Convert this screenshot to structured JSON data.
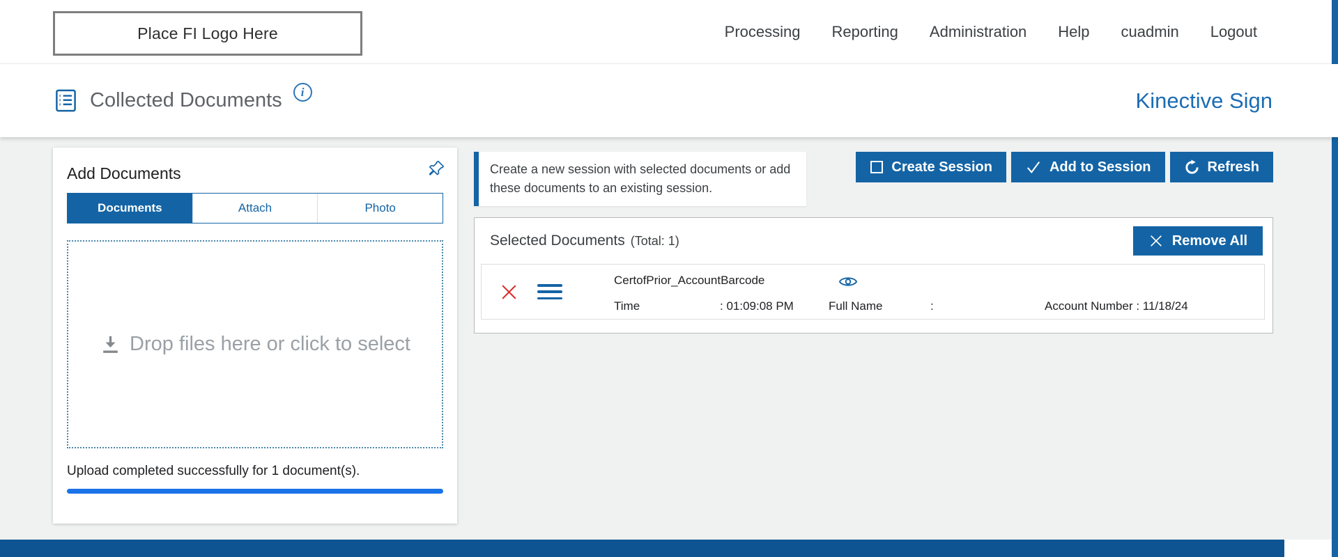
{
  "topnav": {
    "logo_text": "Place FI Logo Here",
    "items": [
      "Processing",
      "Reporting",
      "Administration",
      "Help",
      "cuadmin",
      "Logout"
    ]
  },
  "header": {
    "title": "Collected Documents",
    "info_symbol": "i",
    "brand": "Kinective Sign"
  },
  "add_documents": {
    "title": "Add Documents",
    "tabs": [
      "Documents",
      "Attach",
      "Photo"
    ],
    "dropzone_text": "Drop files here or click to select",
    "status_text": "Upload completed successfully for 1 document(s)."
  },
  "session_actions": {
    "info_text": "Create a new session with selected documents or add these documents to an existing session.",
    "create_label": "Create Session",
    "add_label": "Add to Session",
    "refresh_label": "Refresh"
  },
  "selected_documents": {
    "title": "Selected Documents",
    "total_text": "(Total: 1)",
    "remove_all_label": "Remove All",
    "row": {
      "name": "CertofPrior_AccountBarcode",
      "time_label": "Time",
      "time_value": ": 01:09:08 PM",
      "fullname_label": "Full Name",
      "fullname_value": ":",
      "account_text": "Account Number : 11/18/24"
    }
  },
  "colors": {
    "primary_blue": "#1464a5",
    "brand_blue": "#1b6cb3",
    "progress_blue": "#1a73e8",
    "footer_blue": "#0f5492",
    "delete_red": "#d63031"
  }
}
